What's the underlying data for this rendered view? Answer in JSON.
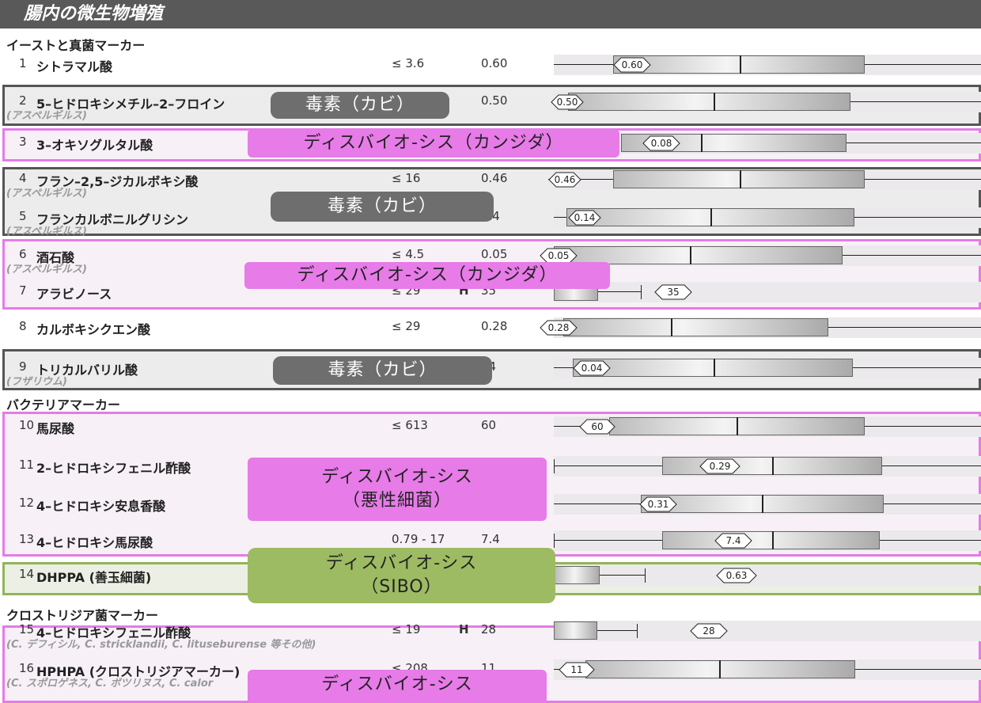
{
  "header": {
    "title": "腸内の微生物増殖"
  },
  "sections": {
    "yeast": "イーストと真菌マーカー",
    "bacteria": "バクテリアマーカー",
    "clostridia": "クロストリジア菌マーカー"
  },
  "rows": [
    {
      "num": "1",
      "name": "シトラマル酸",
      "sub": "",
      "ref": "≤ 3.6",
      "flag": "",
      "value": "0.60"
    },
    {
      "num": "2",
      "name": "5–ヒドロキシメチル–2–フロイン",
      "sub": "(アスペルギルス)",
      "ref": "",
      "flag": "",
      "value": "0.50"
    },
    {
      "num": "3",
      "name": "3–オキソグルタル酸",
      "sub": "",
      "ref": "",
      "flag": "",
      "value": ""
    },
    {
      "num": "4",
      "name": "フラン–2,5–ジカルボキシ酸",
      "sub": "(アスペルギルス)",
      "ref": "≤ 16",
      "flag": "",
      "value": "0.46"
    },
    {
      "num": "5",
      "name": "フランカルボニルグリシン",
      "sub": "(アスペルギルス)",
      "ref": "",
      "flag": "",
      "value": ".14"
    },
    {
      "num": "6",
      "name": "酒石酸",
      "sub": "(アスペルギルス)",
      "ref": "≤ 4.5",
      "flag": "",
      "value": "0.05"
    },
    {
      "num": "7",
      "name": "アラビノース",
      "sub": "",
      "ref": "≤ 29",
      "flag": "H",
      "value": "35"
    },
    {
      "num": "8",
      "name": "カルボキシクエン酸",
      "sub": "",
      "ref": "≤ 29",
      "flag": "",
      "value": "0.28"
    },
    {
      "num": "9",
      "name": "トリカルバリル酸",
      "sub": "(フザリウム)",
      "ref": "",
      "flag": "",
      "value": "04"
    },
    {
      "num": "10",
      "name": "馬尿酸",
      "sub": "",
      "ref": "≤ 613",
      "flag": "",
      "value": "60"
    },
    {
      "num": "11",
      "name": "2–ヒドロキシフェニル酢酸",
      "sub": "",
      "ref": "",
      "flag": "",
      "value": ""
    },
    {
      "num": "12",
      "name": "4–ヒドロキシ安息香酸",
      "sub": "",
      "ref": "",
      "flag": "",
      "value": ""
    },
    {
      "num": "13",
      "name": "4–ヒドロキシ馬尿酸",
      "sub": "",
      "ref": "0.79  -  17",
      "flag": "",
      "value": "7.4"
    },
    {
      "num": "14",
      "name": "DHPPA (善玉細菌)",
      "sub": "",
      "ref": "",
      "flag": "",
      "value": ""
    },
    {
      "num": "15",
      "name": "4–ヒドロキシフェニル酢酸",
      "sub": "(C. デフィシル, C. stricklandii, C. lituseburense 等その他)",
      "ref": "≤ 19",
      "flag": "H",
      "value": "28"
    },
    {
      "num": "16",
      "name": "HPHPA (クロストリジアマーカー)",
      "sub": "(C. スポロゲネス, C. ボツリヌス, C. calor",
      "ref": "≤ 208",
      "flag": "",
      "value": "11"
    }
  ],
  "markers": [
    "0.60",
    "0.50",
    "0.08",
    "0.46",
    "0.14",
    "0.05",
    "35",
    "0.28",
    "0.04",
    "60",
    "0.29",
    "0.31",
    "7.4",
    "0.63",
    "28",
    "11"
  ],
  "labels": {
    "mold1": "毒素（カビ）",
    "candida1": "ディスバイオ-シス（カンジダ）",
    "mold2": "毒素（カビ）",
    "candida2": "ディスバイオ-シス（カンジダ）",
    "mold3": "毒素（カビ）",
    "bad_line1": "ディスバイオ-シス",
    "bad_line2": "（悪性細菌）",
    "sibo_line1": "ディスバイオ-シス",
    "sibo_line2": "（SIBO）",
    "clos_line1": "ディスバイオ-シス"
  },
  "colors": {
    "gray_frame": "#555555",
    "pink_frame": "#e47be8",
    "green_frame": "#92b45a",
    "header": "#595959"
  }
}
